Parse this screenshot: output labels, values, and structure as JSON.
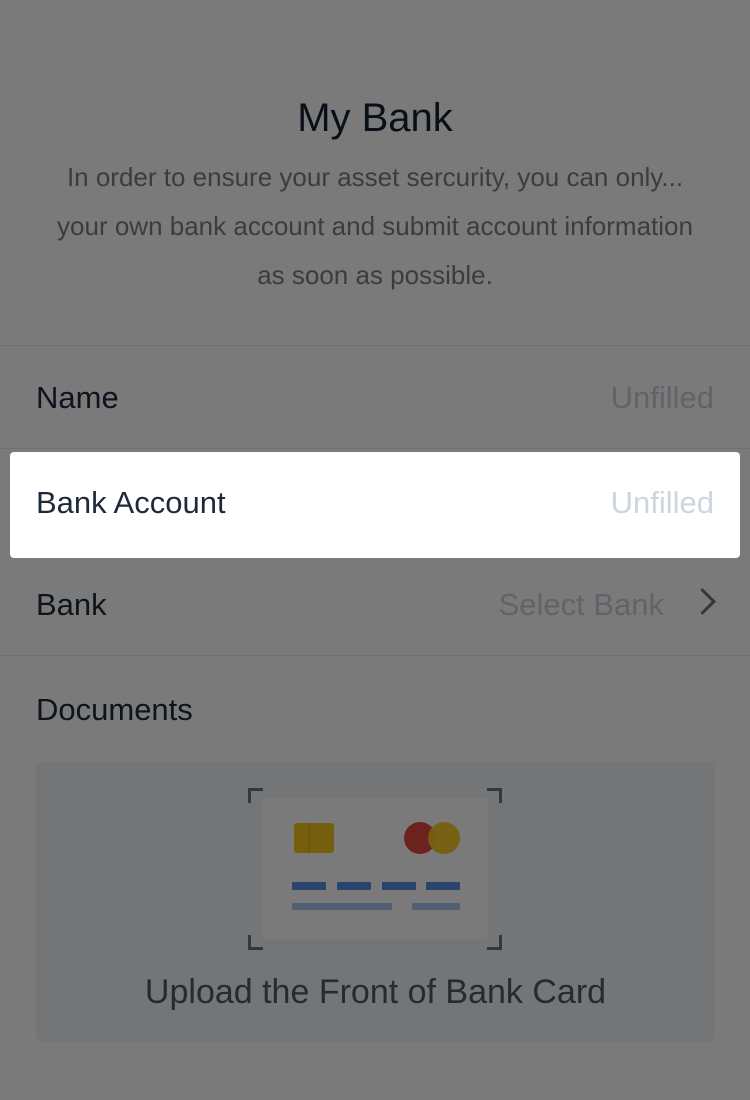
{
  "header": {
    "title": "My Bank",
    "description_lines": [
      "In order to ensure your asset sercurity, you can only...",
      "your own bank account and submit account information",
      "as soon as possible."
    ]
  },
  "form": {
    "name": {
      "label": "Name",
      "placeholder": "Unfilled"
    },
    "bank_account": {
      "label": "Bank Account",
      "placeholder": "Unfilled"
    },
    "bank": {
      "label": "Bank",
      "placeholder": "Select Bank",
      "icon": "chevron-right-icon"
    },
    "documents": {
      "label": "Documents",
      "upload_text": "Upload the Front of Bank Card",
      "icon": "bank-card-illustration"
    }
  },
  "colors": {
    "overlay": "#000000",
    "card_chip": "#f5c71f",
    "card_brand_red": "#e5483f",
    "card_brand_yellow": "#f5c71f",
    "card_dashes": "#5b8ee6",
    "card_lines": "#a9c4ee"
  }
}
